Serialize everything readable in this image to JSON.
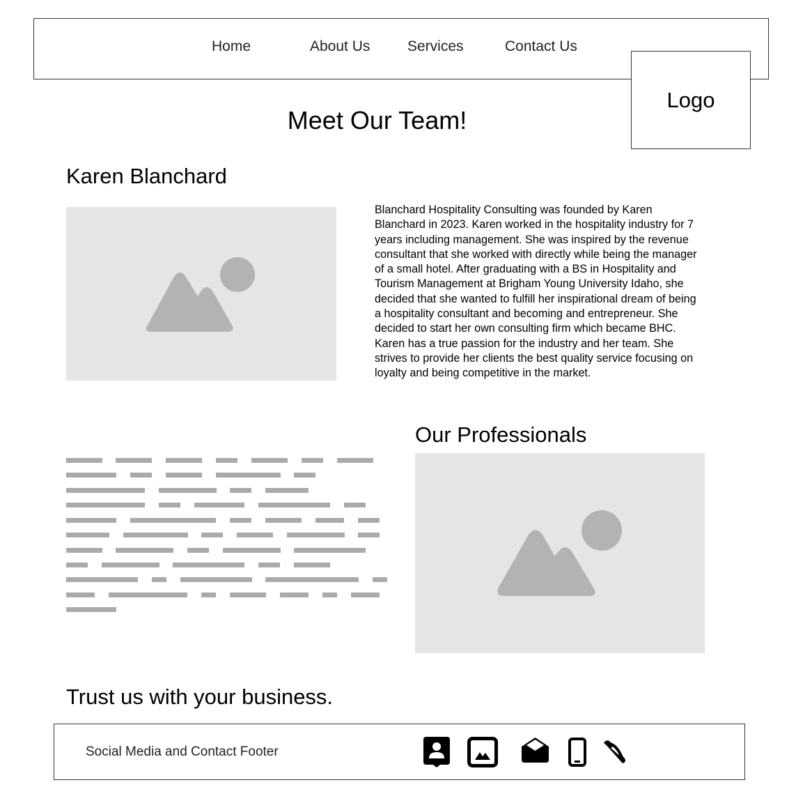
{
  "nav": {
    "items": [
      {
        "label": "Home"
      },
      {
        "label": "About Us"
      },
      {
        "label": "Services"
      },
      {
        "label": "Contact Us"
      }
    ]
  },
  "logo": {
    "label": "Logo"
  },
  "page": {
    "title": "Meet Our Team!"
  },
  "featured": {
    "name": "Karen Blanchard",
    "bio": "Blanchard Hospitality Consulting was founded by Karen Blanchard in 2023. Karen worked in the hospitality industry for 7 years including management. She was inspired by the revenue consultant that she worked with directly while being the manager of a small hotel. After graduating with a BS in Hospitality and Tourism Management at Brigham Young University Idaho, she decided that she wanted to fulfill her inspirational dream of being a hospitality consultant and becoming and entrepreneur. She decided to start her own consulting firm which became BHC. Karen has a true passion for the industry and her team. She strives to provide her clients the best quality service focusing on loyalty and being competitive in the market."
  },
  "professionals": {
    "title": "Our Professionals"
  },
  "tagline": "Trust us with your business.",
  "footer": {
    "label": "Social Media and Contact Footer",
    "icons": [
      "contact-card-icon",
      "image-icon",
      "envelope-icon",
      "mobile-phone-icon",
      "phone-handset-icon"
    ]
  },
  "colors": {
    "placeholder_bg": "#e5e5e5",
    "placeholder_shape": "#b3b3b3",
    "skeleton_line": "#aaaaaa",
    "border": "#333333"
  }
}
